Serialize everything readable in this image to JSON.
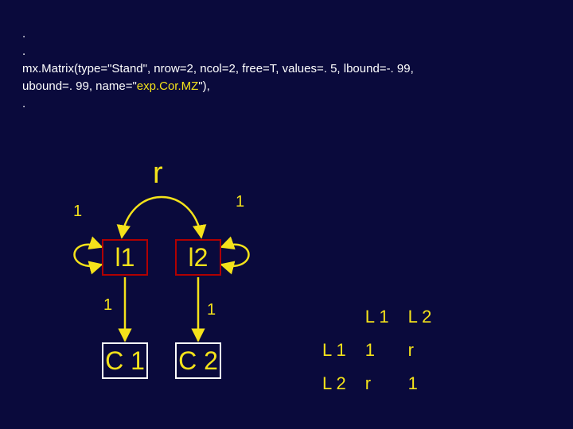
{
  "code": {
    "line1": ".",
    "line2": ".",
    "line3_pre": "mx.Matrix(type=\"Stand\", nrow=2, ncol=2, free=T, values=. 5, lbound=-. 99,",
    "line4_pre": "ubound=. 99, name=\"",
    "line4_hl": "exp.Cor.MZ",
    "line4_post": "\"),",
    "line5": "."
  },
  "diagram": {
    "r_label": "r",
    "self_loop_left_label": "1",
    "self_loop_right_label": "1",
    "latent1": "l1",
    "latent2": "l2",
    "path1_label": "1",
    "path2_label": "1",
    "observed1": "C 1",
    "observed2": "C 2"
  },
  "matrix": {
    "col1": "L 1",
    "col2": "L 2",
    "row1": "L 1",
    "row2": "L 2",
    "cell_11": "1",
    "cell_12": "r",
    "cell_21": "r",
    "cell_22": "1"
  }
}
